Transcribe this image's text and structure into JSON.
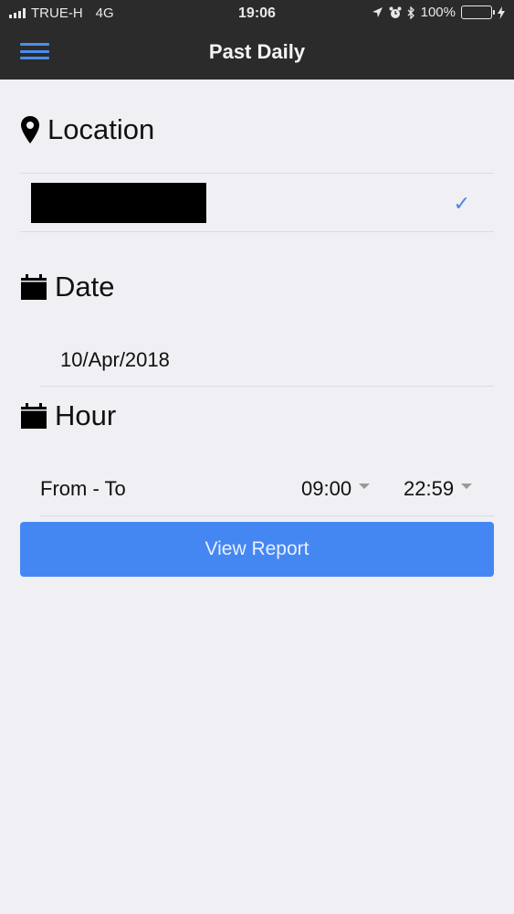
{
  "status_bar": {
    "carrier": "TRUE-H",
    "network": "4G",
    "time": "19:06",
    "battery": "100%"
  },
  "header": {
    "title": "Past Daily"
  },
  "location": {
    "title": "Location"
  },
  "date": {
    "title": "Date",
    "value": "10/Apr/2018"
  },
  "hour": {
    "title": "Hour",
    "label": "From - To",
    "from": "09:00",
    "to": "22:59"
  },
  "actions": {
    "view_report": "View Report"
  },
  "colors": {
    "header_bg": "#2b2b2b",
    "accent": "#4587f2",
    "battery": "#4cd964"
  }
}
